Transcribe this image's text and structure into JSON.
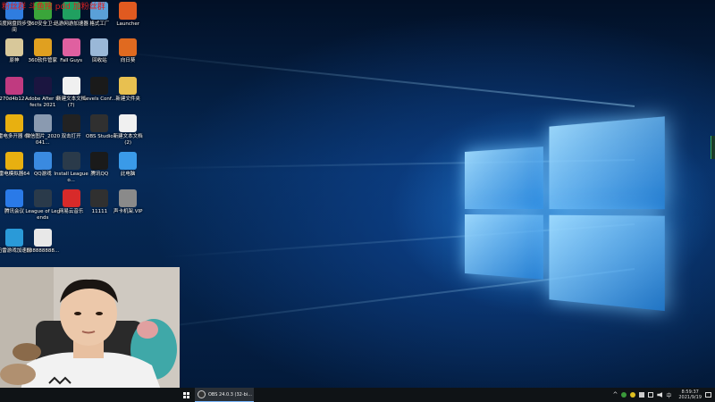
{
  "overlay": {
    "watermark": "粉丝群 斗鱼搜 pdd  加粉丝群"
  },
  "desktop_icons": [
    {
      "label": "百度网盘同步空间",
      "icon": "cloud-folder-icon",
      "color": "#2f7de0"
    },
    {
      "label": "360安全卫士",
      "icon": "shield-icon",
      "color": "#3aa53a"
    },
    {
      "label": "迅游网游加速器",
      "icon": "rocket-icon",
      "color": "#20a060"
    },
    {
      "label": "格式工厂",
      "icon": "factory-icon",
      "color": "#5aa0d8"
    },
    {
      "label": "Launcher",
      "icon": "launcher-icon",
      "color": "#e05a20"
    },
    {
      "label": "原神",
      "icon": "game-icon",
      "color": "#d8c89a"
    },
    {
      "label": "360软件管家",
      "icon": "store-icon",
      "color": "#e0a020"
    },
    {
      "label": "Fall Guys",
      "icon": "fall-guys-icon",
      "color": "#e060a0"
    },
    {
      "label": "回收站",
      "icon": "recycle-bin-icon",
      "color": "#9ab8d8"
    },
    {
      "label": "向日葵",
      "icon": "sunflower-icon",
      "color": "#e06a20"
    },
    {
      "label": "270d4b12...",
      "icon": "winrar-icon",
      "color": "#c03a80"
    },
    {
      "label": "Adobe After Effects 2021",
      "icon": "after-effects-icon",
      "color": "#1b1540"
    },
    {
      "label": "新建文本文档 (7)",
      "icon": "text-file-icon",
      "color": "#f0f0f0"
    },
    {
      "label": "Levels Conf...",
      "icon": "levels-icon",
      "color": "#1a1a1a"
    },
    {
      "label": "新建文件夹",
      "icon": "folder-icon",
      "color": "#e8c050"
    },
    {
      "label": "雷电多开器 64",
      "icon": "emulator-icon",
      "color": "#e8b010"
    },
    {
      "label": "微信图片_2020041...",
      "icon": "image-icon",
      "color": "#8a9ab0"
    },
    {
      "label": "双击打开",
      "icon": "app-icon",
      "color": "#222222"
    },
    {
      "label": "OBS Studio",
      "icon": "obs-icon",
      "color": "#303030"
    },
    {
      "label": "新建文本文档 (2)",
      "icon": "text-file-icon",
      "color": "#f0f0f0"
    },
    {
      "label": "雷电模拟器64",
      "icon": "emulator-icon",
      "color": "#e8b010"
    },
    {
      "label": "QQ游戏",
      "icon": "qq-game-icon",
      "color": "#3a8ae0"
    },
    {
      "label": "Install League o...",
      "icon": "league-icon",
      "color": "#2a3a4a"
    },
    {
      "label": "腾讯QQ",
      "icon": "qq-icon",
      "color": "#1a1a1a"
    },
    {
      "label": "此电脑",
      "icon": "computer-icon",
      "color": "#3a9ae8"
    },
    {
      "label": "腾讯会议",
      "icon": "meeting-icon",
      "color": "#2a7ae8"
    },
    {
      "label": "League of Legends",
      "icon": "league-icon",
      "color": "#2a3a4a"
    },
    {
      "label": "网易云音乐",
      "icon": "music-icon",
      "color": "#d82a2a"
    },
    {
      "label": "11111",
      "icon": "file-icon",
      "color": "#303030"
    },
    {
      "label": "声卡机架.VIP",
      "icon": "soundcard-icon",
      "color": "#8a8a8a"
    },
    {
      "label": "迅雷游戏加速器",
      "icon": "accelerator-icon",
      "color": "#2a9ad8"
    },
    {
      "label": "888888888...",
      "icon": "file-icon",
      "color": "#e8e8e8"
    }
  ],
  "taskbar": {
    "active_app": "OBS 24.0.3 (32-bi...",
    "clock_time": "8:59:37",
    "clock_date": "2021/9/19"
  }
}
